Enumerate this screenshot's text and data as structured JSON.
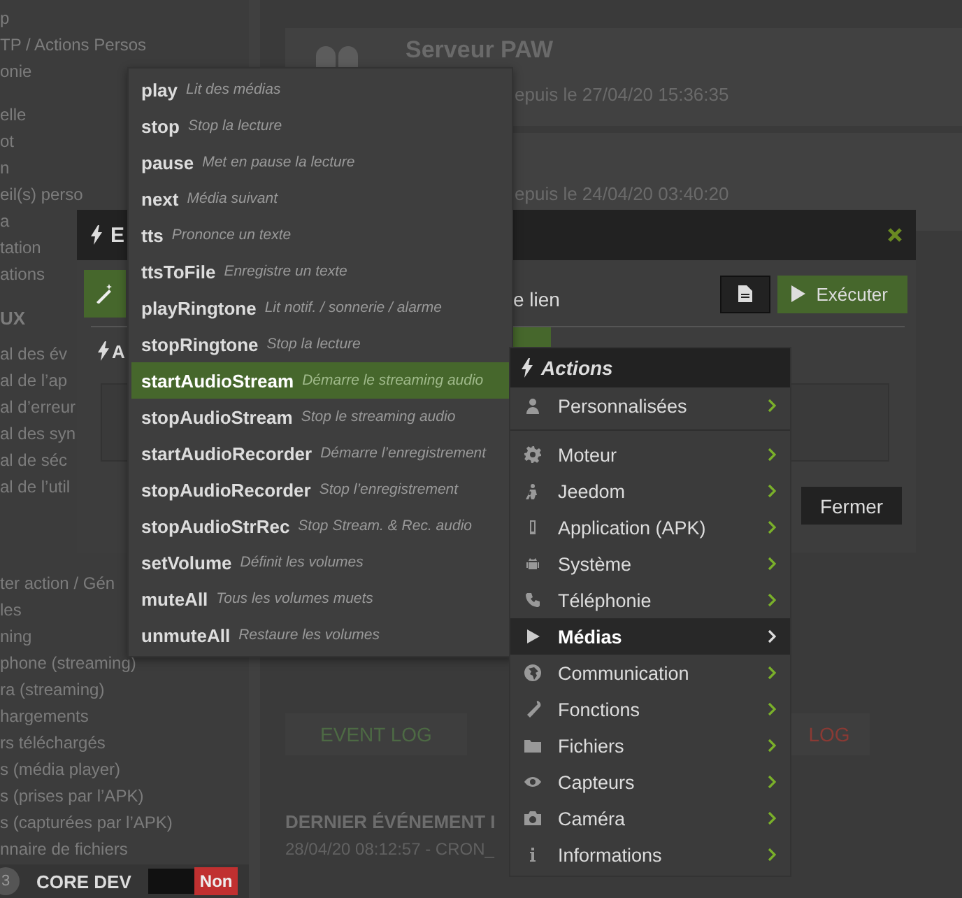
{
  "sidebar": {
    "sections": [
      {
        "items": [
          "p",
          "TP / Actions Persos",
          "onie"
        ]
      },
      {
        "items": [
          "elle",
          "ot",
          "n",
          "eil(s) perso",
          "a",
          "tation",
          "ations"
        ]
      },
      {
        "header": "UX",
        "items": [
          "al des év",
          "al de l’ap",
          "al d’erreur",
          "al des syn",
          "al de séc",
          "al de l’util"
        ]
      },
      {
        "items": [
          "ter action / Gén",
          "les",
          "ning",
          "phone (streaming)",
          "ra (streaming)",
          "hargements",
          "rs téléchargés",
          "s (média player)",
          "s (prises par l’APK)",
          "s (capturées par l’APK)",
          "nnaire de fichiers"
        ]
      }
    ],
    "footer": {
      "badge": "3",
      "name": "CORE DEV",
      "status": "Non"
    }
  },
  "cards": [
    {
      "title": "Serveur PAW",
      "subtitle": "epuis le 27/04/20 15:36:35"
    },
    {
      "subtitle": "epuis le 24/04/20 03:40:20"
    }
  ],
  "log_buttons": [
    {
      "label": "EVENT LOG",
      "kind": "event"
    },
    {
      "label": "LOG",
      "kind": "error"
    }
  ],
  "last_event": {
    "title": "DERNIER ÉVÉNEMENT I",
    "text": "28/04/20 08:12:57 - CRON_"
  },
  "dialog": {
    "title": "E",
    "link_label": "e lien",
    "execute": "Exécuter",
    "section_label": "A",
    "close": "Fermer"
  },
  "command_menu": [
    {
      "name": "play",
      "description": "Lit des médias",
      "selected": false
    },
    {
      "name": "stop",
      "description": "Stop la lecture",
      "selected": false
    },
    {
      "name": "pause",
      "description": "Met en pause la lecture",
      "selected": false
    },
    {
      "name": "next",
      "description": "Média suivant",
      "selected": false
    },
    {
      "name": "tts",
      "description": "Prononce un texte",
      "selected": false
    },
    {
      "name": "ttsToFile",
      "description": "Enregistre un texte",
      "selected": false
    },
    {
      "name": "playRingtone",
      "description": "Lit notif. / sonnerie / alarme",
      "selected": false
    },
    {
      "name": "stopRingtone",
      "description": "Stop la lecture",
      "selected": false
    },
    {
      "name": "startAudioStream",
      "description": "Démarre le streaming audio",
      "selected": true
    },
    {
      "name": "stopAudioStream",
      "description": "Stop le streaming audio",
      "selected": false
    },
    {
      "name": "startAudioRecorder",
      "description": "Démarre l’enregistrement",
      "selected": false
    },
    {
      "name": "stopAudioRecorder",
      "description": "Stop l’enregistrement",
      "selected": false
    },
    {
      "name": "stopAudioStrRec",
      "description": "Stop Stream. & Rec. audio",
      "selected": false
    },
    {
      "name": "setVolume",
      "description": "Définit les volumes",
      "selected": false
    },
    {
      "name": "muteAll",
      "description": "Tous les volumes muets",
      "selected": false
    },
    {
      "name": "unmuteAll",
      "description": "Restaure les volumes",
      "selected": false
    }
  ],
  "actions_menu": {
    "title": "Actions",
    "items": [
      {
        "label": "Personnalisées",
        "selected": false
      },
      {
        "label": "Moteur",
        "selected": false
      },
      {
        "label": "Jeedom",
        "selected": false
      },
      {
        "label": "Application (APK)",
        "selected": false
      },
      {
        "label": "Système",
        "selected": false
      },
      {
        "label": "Téléphonie",
        "selected": false
      },
      {
        "label": "Médias",
        "selected": true
      },
      {
        "label": "Communication",
        "selected": false
      },
      {
        "label": "Fonctions",
        "selected": false
      },
      {
        "label": "Fichiers",
        "selected": false
      },
      {
        "label": "Capteurs",
        "selected": false
      },
      {
        "label": "Caméra",
        "selected": false
      },
      {
        "label": "Informations",
        "selected": false
      }
    ]
  }
}
